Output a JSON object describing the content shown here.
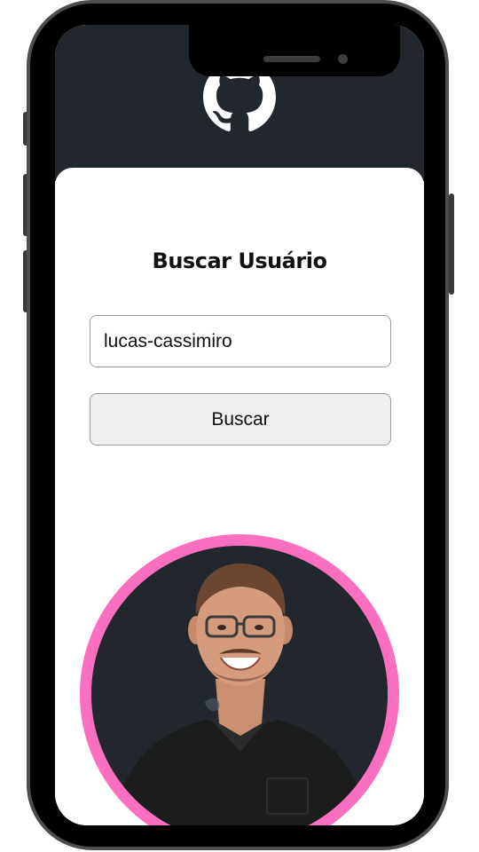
{
  "colors": {
    "header_bg": "#22272e",
    "card_bg": "#ffffff",
    "avatar_ring": "#fb6fc0",
    "avatar_bg": "#22272e",
    "button_bg": "#efefef",
    "frame": "#4d4d4d"
  },
  "header": {
    "logo_icon": "github-octocat-icon"
  },
  "main": {
    "title": "Buscar Usuário",
    "search": {
      "value": "lucas-cassimiro",
      "placeholder": ""
    },
    "search_button_label": "Buscar",
    "avatar_icon": "user-avatar-photo"
  }
}
